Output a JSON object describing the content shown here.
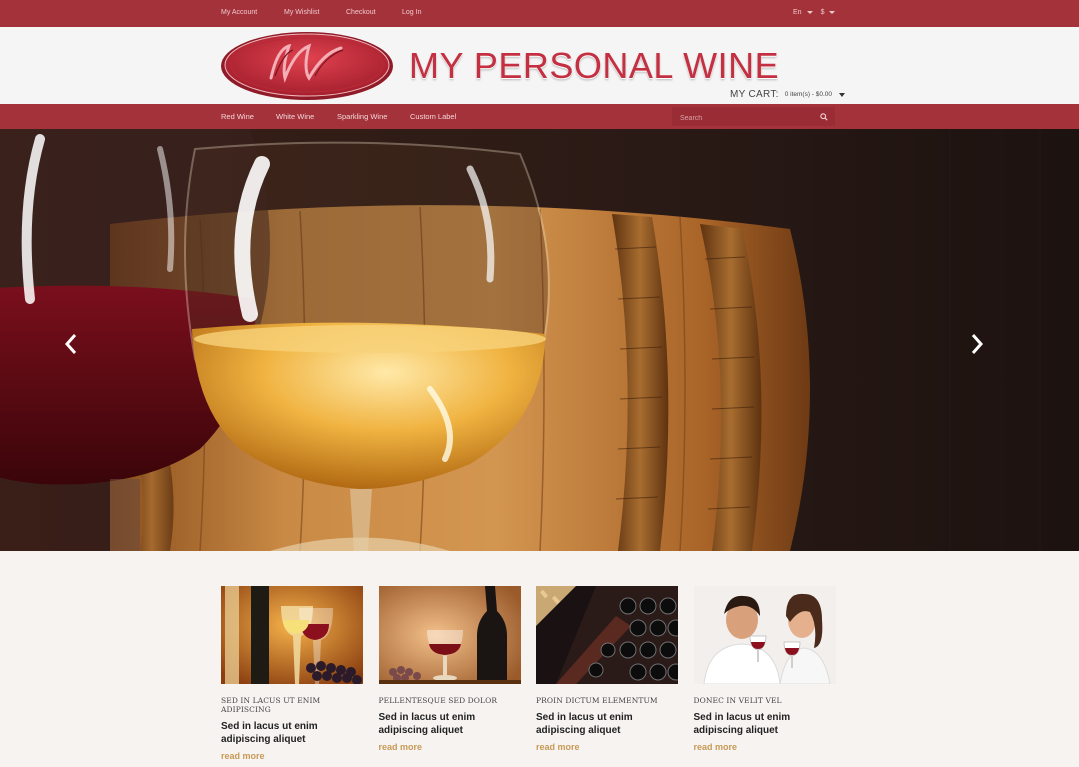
{
  "topbar": {
    "links": [
      "My Account",
      "My Wishlist",
      "Checkout",
      "Log In"
    ],
    "language": "En",
    "currency": "$"
  },
  "header": {
    "logo_text": "MW",
    "brand": "MY PERSONAL WINE",
    "cart_label": "MY CART:",
    "cart_value": "0 item(s) - $0.00"
  },
  "nav": {
    "items": [
      "Red Wine",
      "White Wine",
      "Sparkling Wine",
      "Custom Label"
    ],
    "search_placeholder": "Search"
  },
  "hero": {
    "prev_icon": "chevron-left-icon",
    "next_icon": "chevron-right-icon"
  },
  "posts": [
    {
      "category": "SED IN LACUS UT ENIM ADIPISCING",
      "title": "Sed in lacus ut enim adipiscing aliquet",
      "more": "read more"
    },
    {
      "category": "PELLENTESQUE SED DOLOR",
      "title": "Sed in lacus ut enim adipiscing aliquet",
      "more": "read more"
    },
    {
      "category": "PROIN DICTUM ELEMENTUM",
      "title": "Sed in lacus ut enim adipiscing aliquet",
      "more": "read more"
    },
    {
      "category": "DONEC IN VELIT VEL",
      "title": "Sed in lacus ut enim adipiscing aliquet",
      "more": "read more"
    }
  ],
  "colors": {
    "brand_red": "#a3323b",
    "logo_red": "#c42f42",
    "link_gold": "#c89a55"
  }
}
